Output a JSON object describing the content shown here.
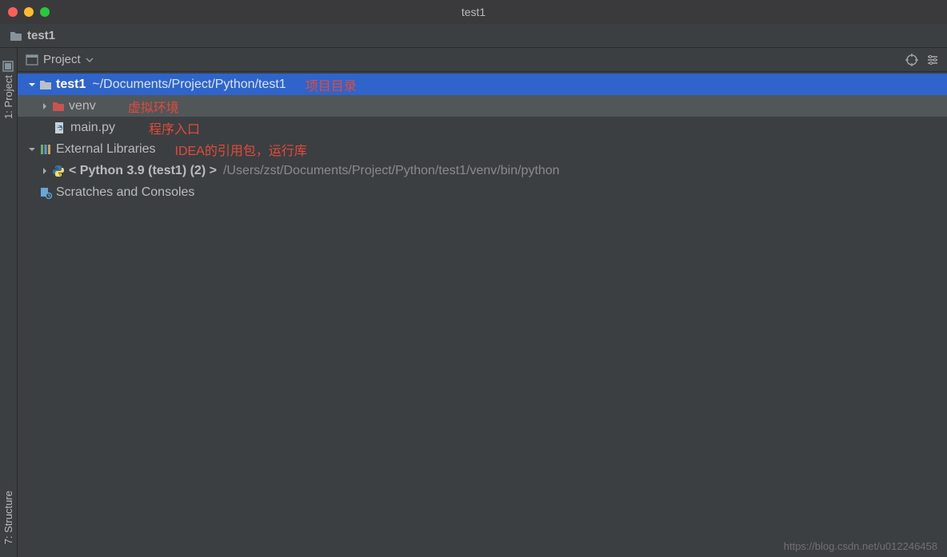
{
  "titlebar": {
    "title": "test1"
  },
  "breadcrumb": {
    "project_name": "test1"
  },
  "left_sidebar": {
    "tab_project": "1: Project",
    "tab_structure": "7: Structure"
  },
  "panel_header": {
    "label": "Project"
  },
  "tree": {
    "root": {
      "name": "test1",
      "path": "~/Documents/Project/Python/test1",
      "annotation": "项目目录"
    },
    "venv": {
      "name": "venv",
      "annotation": "虚拟环境"
    },
    "main_py": {
      "name": "main.py",
      "annotation": "程序入口"
    },
    "external_libraries": {
      "name": "External Libraries",
      "annotation": "IDEA的引用包，运行库"
    },
    "python_sdk": {
      "name": "< Python 3.9 (test1) (2) >",
      "path": "/Users/zst/Documents/Project/Python/test1/venv/bin/python"
    },
    "scratches": {
      "name": "Scratches and Consoles"
    }
  },
  "watermark": "https://blog.csdn.net/u012246458"
}
